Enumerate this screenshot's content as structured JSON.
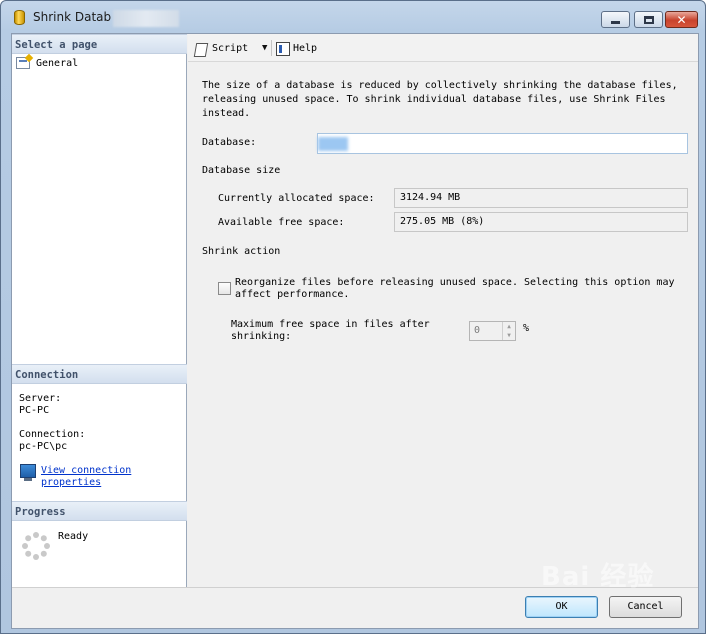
{
  "window": {
    "title": "Shrink Datab",
    "buttons": {
      "minimize": "minimize",
      "maximize": "maximize",
      "close": "✕"
    }
  },
  "left": {
    "select_page_header": "Select a page",
    "pages": [
      {
        "label": "General",
        "icon": "page-settings-icon"
      }
    ],
    "connection_header": "Connection",
    "server_label": "Server:",
    "server_value": "PC-PC",
    "connection_label": "Connection:",
    "connection_value": "pc-PC\\pc",
    "view_connection_link": "View connection properties",
    "progress_header": "Progress",
    "progress_status": "Ready"
  },
  "toolbar": {
    "script_label": "Script",
    "help_label": "Help"
  },
  "main": {
    "description": "The size of a database is reduced by collectively shrinking the database files, releasing unused space. To shrink individual database files, use Shrink Files instead.",
    "database_label": "Database:",
    "database_value": "",
    "database_size_header": "Database size",
    "allocated_label": "Currently allocated space:",
    "allocated_value": "3124.94 MB",
    "free_label": "Available free space:",
    "free_value": "275.05 MB (8%)",
    "shrink_action_header": "Shrink action",
    "reorganize_label": "Reorganize files before releasing unused space.  Selecting this option may affect performance.",
    "reorganize_checked": false,
    "max_free_label": "Maximum free space in files after shrinking:",
    "max_free_value": "0",
    "max_free_unit": "%"
  },
  "footer": {
    "ok_label": "OK",
    "cancel_label": "Cancel"
  },
  "watermark": "Bai 经验"
}
